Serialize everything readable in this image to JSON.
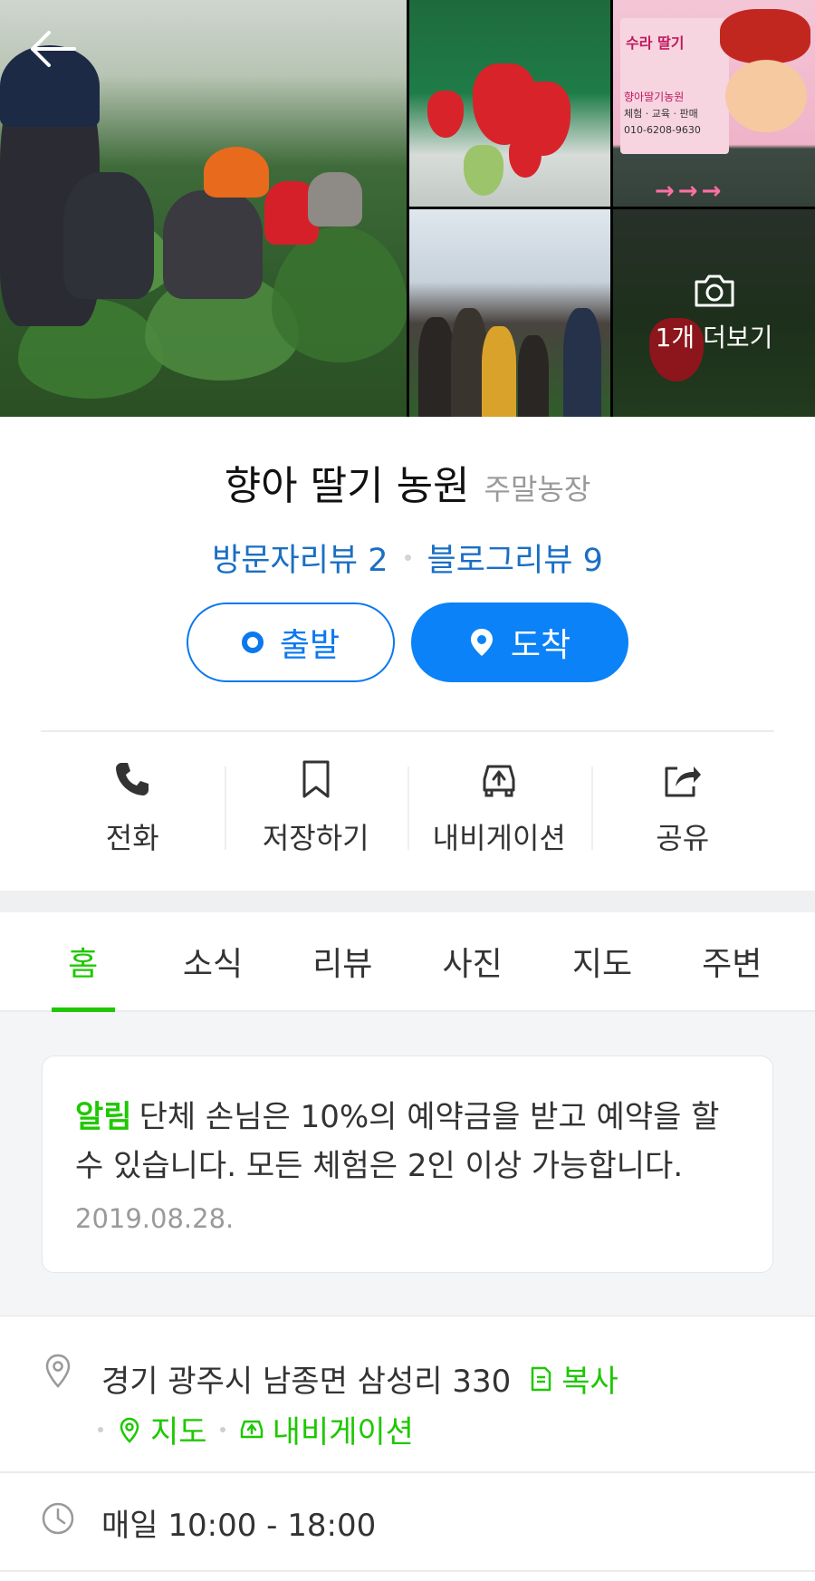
{
  "gallery": {
    "more_label": "1개 더보기",
    "sign_title": "수라 딸기",
    "sign_farm": "향아딸기농원",
    "sign_services": "체험 · 교육 · 판매",
    "sign_phone": "010-6208-9630",
    "sign_arrows": "→→→"
  },
  "place": {
    "name": "향아 딸기 농원",
    "category": "주말농장",
    "visitor_reviews": "방문자리뷰 2",
    "blog_reviews": "블로그리뷰 9"
  },
  "route": {
    "depart_label": "출발",
    "arrive_label": "도착"
  },
  "actions": [
    {
      "label": "전화",
      "icon": "phone-icon"
    },
    {
      "label": "저장하기",
      "icon": "bookmark-icon"
    },
    {
      "label": "내비게이션",
      "icon": "car-navigation-icon"
    },
    {
      "label": "공유",
      "icon": "share-icon"
    }
  ],
  "tabs": [
    {
      "label": "홈",
      "active": true
    },
    {
      "label": "소식",
      "active": false
    },
    {
      "label": "리뷰",
      "active": false
    },
    {
      "label": "사진",
      "active": false
    },
    {
      "label": "지도",
      "active": false
    },
    {
      "label": "주변",
      "active": false
    }
  ],
  "notice": {
    "label": "알림",
    "text": "단체 손님은 10%의 예약금을 받고 예약을 할 수 있습니다. 모든 체험은 2인 이상 가능합니다.",
    "date": "2019.08.28."
  },
  "info": {
    "address": "경기 광주시 남종면 삼성리 330",
    "copy_label": "복사",
    "map_label": "지도",
    "nav_label": "내비게이션",
    "hours": "매일 10:00 - 18:00"
  },
  "colors": {
    "accent_green": "#1ec800",
    "accent_blue": "#0b82f7",
    "link_blue": "#1a6fc4"
  }
}
